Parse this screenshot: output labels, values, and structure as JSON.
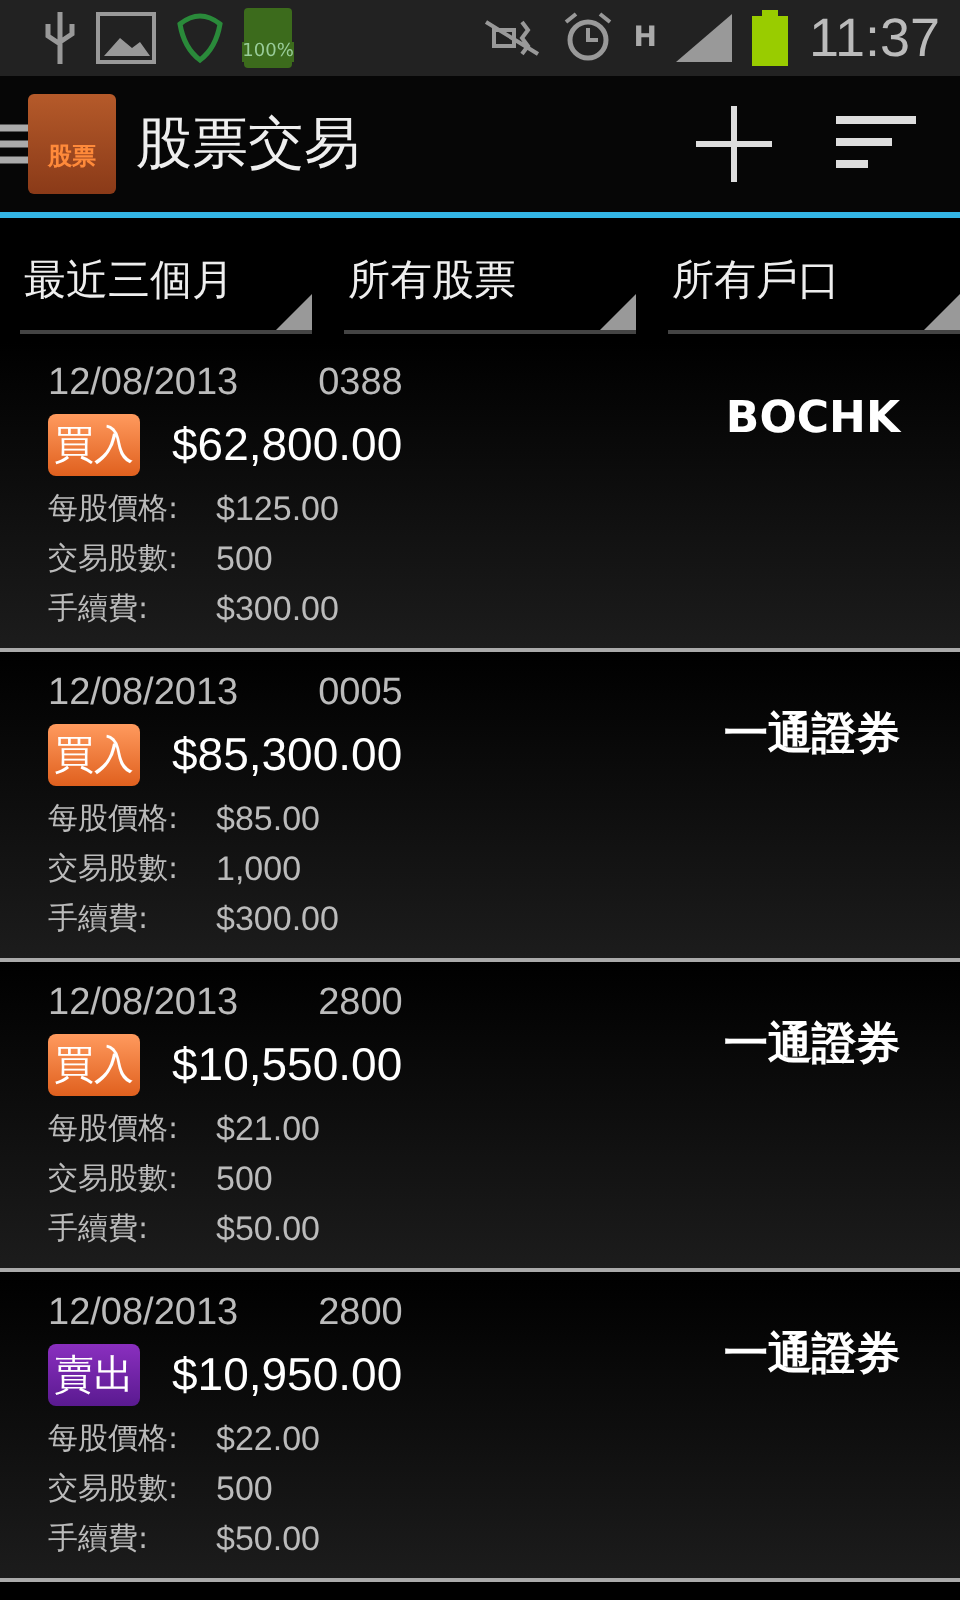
{
  "status_bar": {
    "battery_label": "100%",
    "network": "H",
    "time": "11:37"
  },
  "action_bar": {
    "logo_label": "股票",
    "title": "股票交易"
  },
  "filters": [
    {
      "label": "最近三個月"
    },
    {
      "label": "所有股票"
    },
    {
      "label": "所有戶口"
    }
  ],
  "trades": [
    {
      "date": "12/08/2013",
      "code": "0388",
      "kind": "buy",
      "type_label": "買入",
      "amount": "$62,800.00",
      "account": "BOCHK",
      "details": [
        {
          "label": "每股價格:",
          "value": "$125.00"
        },
        {
          "label": "交易股數:",
          "value": "500"
        },
        {
          "label": "手續費:",
          "value": "$300.00"
        }
      ]
    },
    {
      "date": "12/08/2013",
      "code": "0005",
      "kind": "buy",
      "type_label": "買入",
      "amount": "$85,300.00",
      "account": "一通證券",
      "details": [
        {
          "label": "每股價格:",
          "value": "$85.00"
        },
        {
          "label": "交易股數:",
          "value": "1,000"
        },
        {
          "label": "手續費:",
          "value": "$300.00"
        }
      ]
    },
    {
      "date": "12/08/2013",
      "code": "2800",
      "kind": "buy",
      "type_label": "買入",
      "amount": "$10,550.00",
      "account": "一通證券",
      "details": [
        {
          "label": "每股價格:",
          "value": "$21.00"
        },
        {
          "label": "交易股數:",
          "value": "500"
        },
        {
          "label": "手續費:",
          "value": "$50.00"
        }
      ]
    },
    {
      "date": "12/08/2013",
      "code": "2800",
      "kind": "sell",
      "type_label": "賣出",
      "amount": "$10,950.00",
      "account": "一通證券",
      "details": [
        {
          "label": "每股價格:",
          "value": "$22.00"
        },
        {
          "label": "交易股數:",
          "value": "500"
        },
        {
          "label": "手續費:",
          "value": "$50.00"
        }
      ]
    }
  ]
}
